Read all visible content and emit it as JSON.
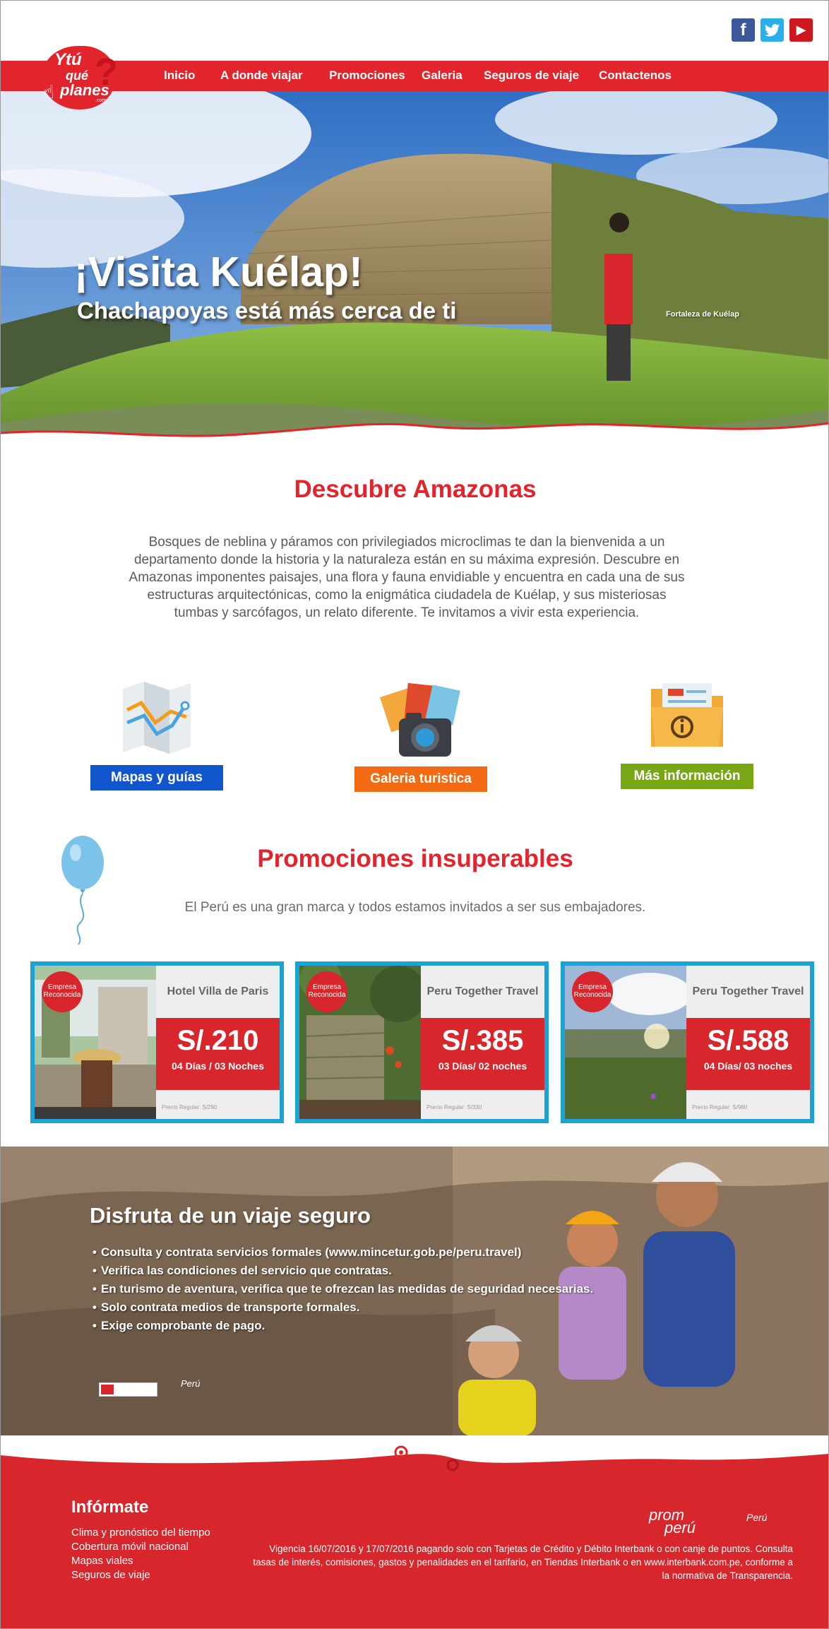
{
  "social": {
    "facebook": "f",
    "twitter": "t",
    "youtube": "▶"
  },
  "logo": {
    "line1": "Ytú",
    "line2": "qué",
    "line3": "planes",
    "line4": ".com",
    "mark": "?"
  },
  "nav": {
    "items": [
      {
        "label": "Inicio"
      },
      {
        "label": "A donde viajar"
      },
      {
        "label": "Promociones"
      },
      {
        "label": "Galeria"
      },
      {
        "label": "Seguros de viaje"
      },
      {
        "label": "Contactenos"
      }
    ]
  },
  "hero": {
    "title": "¡Visita Kuélap!",
    "subtitle": "Chachapoyas está más cerca de ti",
    "caption": "Fortaleza de Kuélap"
  },
  "discover": {
    "title": "Descubre Amazonas",
    "text": "Bosques de neblina y páramos con privilegiados microclimas te dan la bienvenida a un departamento donde la historia y la naturaleza están en su máxima expresión. Descubre en Amazonas imponentes paisajes, una flora y fauna envidiable y encuentra en cada una de sus estructuras arquitectónicas, como la enigmática ciudadela de Kuélap, y sus misteriosas tumbas y sarcófagos, un relato diferente. Te invitamos a vivir esta experiencia."
  },
  "features": [
    {
      "label": "Mapas y guías",
      "icon": "map-icon",
      "color": "#1155cc"
    },
    {
      "label": "Galeria turistica",
      "icon": "camera-photos-icon",
      "color": "#f26b12"
    },
    {
      "label": "Más información",
      "icon": "info-folder-icon",
      "color": "#78a614"
    }
  ],
  "promos": {
    "title": "Promociones insuperables",
    "subtitle": "El Perú es una gran marca y todos estamos invitados a ser sus embajadores.",
    "badge": "Empresa Reconocida",
    "cards": [
      {
        "name": "Hotel Villa de Paris",
        "price": "S/.210",
        "duration": "04 Días / 03 Noches",
        "regular": "Precio Regular: S/290"
      },
      {
        "name": "Peru Together Travel",
        "price": "S/.385",
        "duration": "03 Días/ 02 noches",
        "regular": "Precio Regular: S/330"
      },
      {
        "name": "Peru Together Travel",
        "price": "S/.588",
        "duration": "04 Días/ 03 noches",
        "regular": "Precio Regular: S/980"
      }
    ]
  },
  "safety": {
    "title": "Disfruta de un viaje seguro",
    "items": [
      "Consulta y contrata servicios formales (www.mincetur.gob.pe/peru.travel)",
      "Verifica las condiciones del servicio que contratas.",
      "En turismo de aventura, verifica que te ofrezcan las medidas de seguridad necesarias.",
      "Solo contrata medios de transporte formales.",
      "Exige comprobante de pago."
    ],
    "peru_mark": "Perú"
  },
  "footer": {
    "title": "Infórmate",
    "links": [
      "Clima y pronóstico del tiempo",
      "Cobertura móvil nacional",
      "Mapas viales",
      "Seguros de viaje"
    ],
    "legal": "Vigencia 16/07/2016 y 17/07/2016 pagando solo con Tarjetas de Crédito y Débito Interbank o con canje de puntos. Consulta tasas de interés, comisiones, gastos y penalidades en el tarifario, en Tiendas Interbank o en www.interbank.com.pe, conforme a la normativa de Transparencia.",
    "prom_line1": "prom",
    "prom_line2": "perú",
    "peru_mark": "Perú"
  },
  "colors": {
    "brand_red": "#e2252c",
    "card_border": "#1aa3d3"
  }
}
